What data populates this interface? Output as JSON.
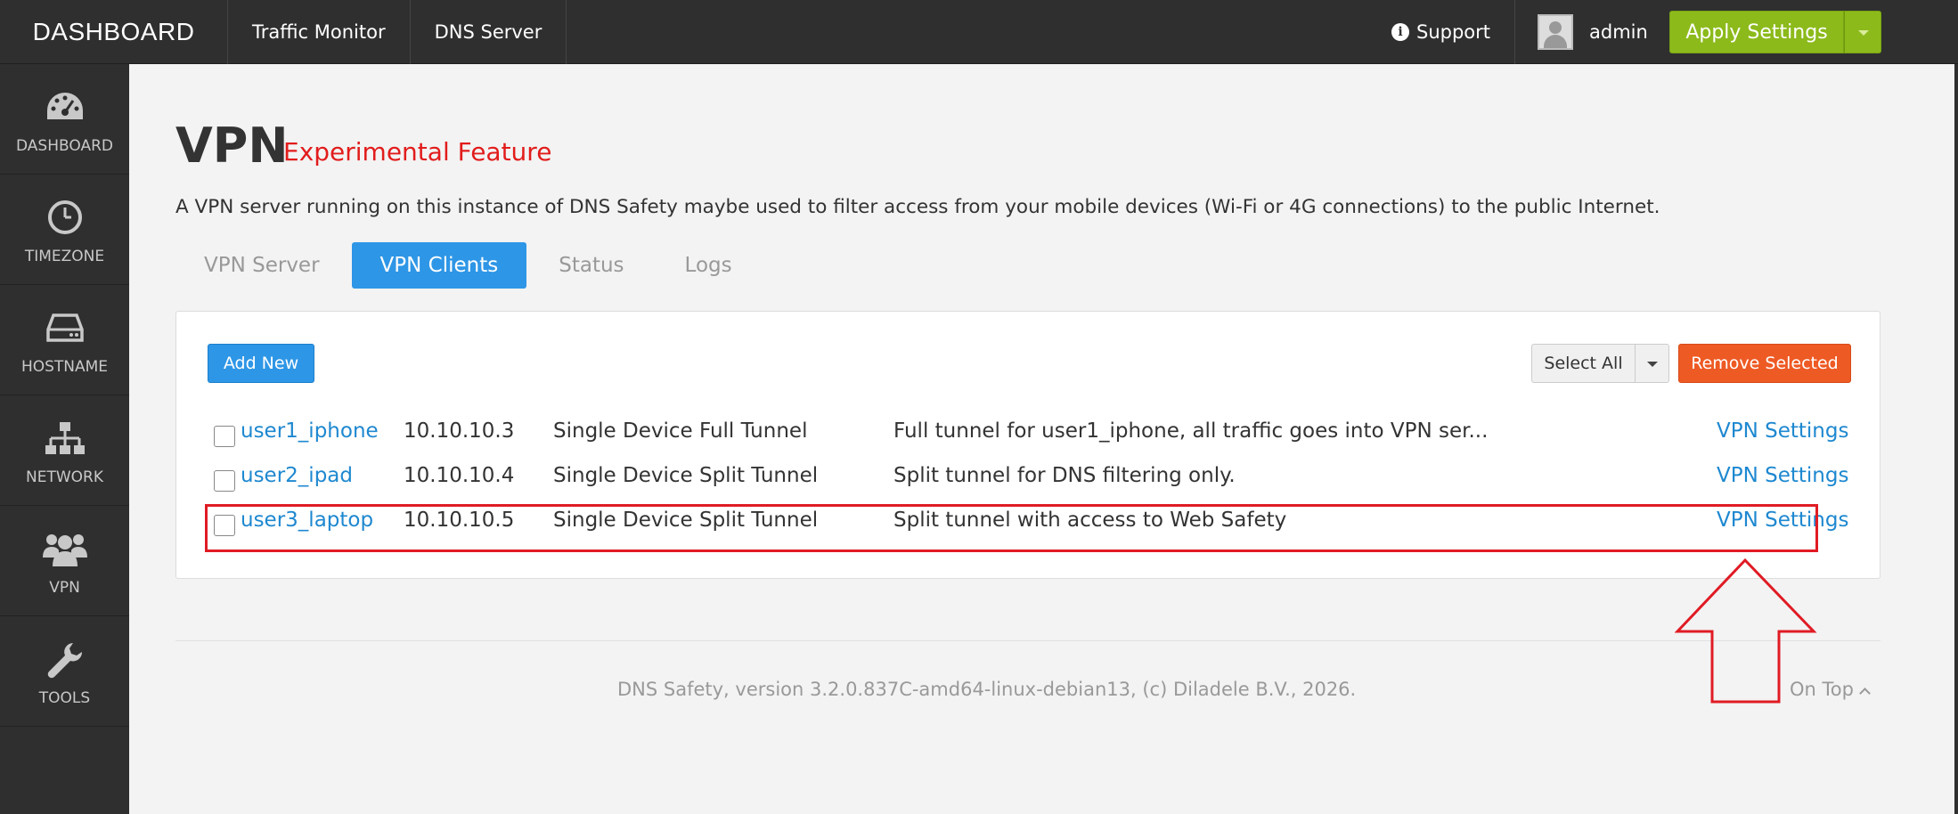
{
  "topbar": {
    "brand": "DASHBOARD",
    "nav": [
      "Traffic Monitor",
      "DNS Server"
    ],
    "support": "Support",
    "user": "admin",
    "apply": "Apply Settings"
  },
  "sidebar": {
    "items": [
      {
        "label": "DASHBOARD",
        "icon": "speedometer-icon"
      },
      {
        "label": "TIMEZONE",
        "icon": "clock-icon"
      },
      {
        "label": "HOSTNAME",
        "icon": "hard-drive-icon"
      },
      {
        "label": "NETWORK",
        "icon": "network-icon"
      },
      {
        "label": "VPN",
        "icon": "users-icon"
      },
      {
        "label": "TOOLS",
        "icon": "wrench-icon"
      }
    ]
  },
  "page": {
    "title": "VPN",
    "subtitle": "Experimental Feature",
    "description": "A VPN server running on this instance of DNS Safety maybe used to filter access from your mobile devices (Wi-Fi or 4G connections) to the public Internet."
  },
  "tabs": [
    {
      "label": "VPN Server",
      "active": false
    },
    {
      "label": "VPN Clients",
      "active": true
    },
    {
      "label": "Status",
      "active": false
    },
    {
      "label": "Logs",
      "active": false
    }
  ],
  "toolbar": {
    "add": "Add New",
    "select_all": "Select All",
    "remove": "Remove Selected"
  },
  "clients": [
    {
      "name": "user1_iphone",
      "ip": "10.10.10.3",
      "type": "Single Device Full Tunnel",
      "description": "Full tunnel for user1_iphone, all traffic goes into VPN ser...",
      "link": "VPN Settings"
    },
    {
      "name": "user2_ipad",
      "ip": "10.10.10.4",
      "type": "Single Device Split Tunnel",
      "description": "Split tunnel for DNS filtering only.",
      "link": "VPN Settings"
    },
    {
      "name": "user3_laptop",
      "ip": "10.10.10.5",
      "type": "Single Device Split Tunnel",
      "description": "Split tunnel with access to Web Safety",
      "link": "VPN Settings"
    }
  ],
  "footer": {
    "text": "DNS Safety, version 3.2.0.837C-amd64-linux-debian13, (c) Diladele B.V., 2026.",
    "ontop": "On Top"
  },
  "colors": {
    "accent": "#2e96e6",
    "apply": "#8cba1b",
    "danger": "#ee5a24",
    "annotation": "#e01b24"
  }
}
